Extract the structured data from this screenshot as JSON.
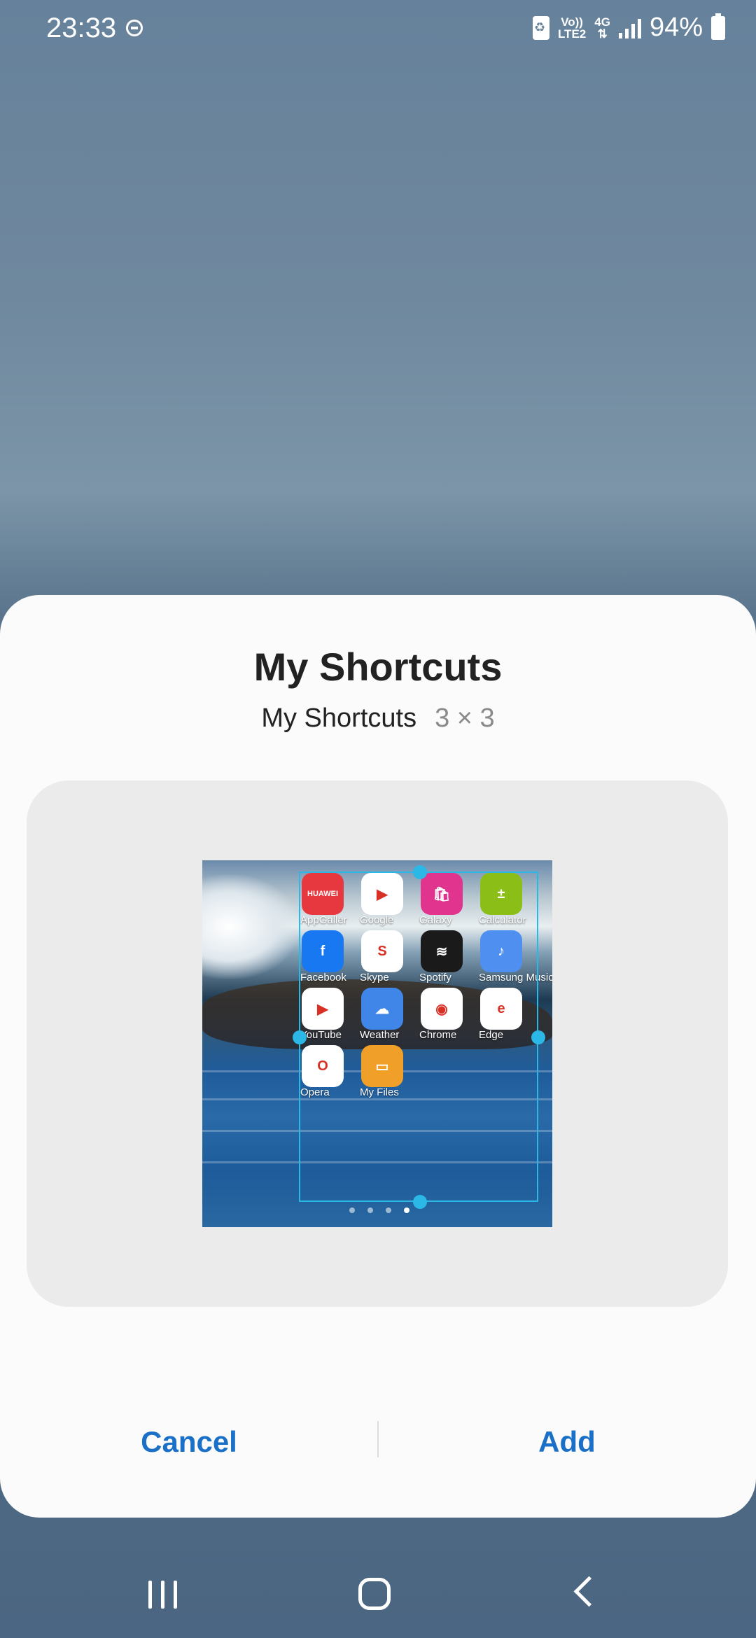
{
  "status_bar": {
    "time": "23:33",
    "network_line1": "Vo))",
    "network_line2": "LTE2",
    "network_type": "4G",
    "battery": "94%"
  },
  "sheet": {
    "title": "My Shortcuts",
    "subtitle": "My Shortcuts",
    "size": "3 × 3"
  },
  "preview": {
    "apps": [
      {
        "label": "AppGaller",
        "icon": "huawei-appgallery-icon",
        "color": "#e8383f",
        "glyph": "HUAWEI"
      },
      {
        "label": "Google",
        "icon": "google-play-icon",
        "color": "#ffffff",
        "glyph": "▶"
      },
      {
        "label": "Galaxy",
        "icon": "galaxy-store-icon",
        "color": "#e0348f",
        "glyph": "🛍"
      },
      {
        "label": "Calculator",
        "icon": "calculator-icon",
        "color": "#8bbf18",
        "glyph": "±"
      },
      {
        "label": "Facebook",
        "icon": "facebook-icon",
        "color": "#1778f2",
        "glyph": "f"
      },
      {
        "label": "Skype",
        "icon": "skype-icon",
        "color": "#ffffff",
        "glyph": "S"
      },
      {
        "label": "Spotify",
        "icon": "spotify-icon",
        "color": "#1a1a1a",
        "glyph": "≋"
      },
      {
        "label": "Samsung Music",
        "icon": "samsung-music-icon",
        "color": "#4f8ff0",
        "glyph": "♪"
      },
      {
        "label": "YouTube",
        "icon": "youtube-icon",
        "color": "#ffffff",
        "glyph": "▶"
      },
      {
        "label": "Weather",
        "icon": "weather-icon",
        "color": "#3f86e8",
        "glyph": "☁"
      },
      {
        "label": "Chrome",
        "icon": "chrome-icon",
        "color": "#ffffff",
        "glyph": "◉"
      },
      {
        "label": "Edge",
        "icon": "edge-icon",
        "color": "#ffffff",
        "glyph": "e"
      },
      {
        "label": "Opera",
        "icon": "opera-icon",
        "color": "#ffffff",
        "glyph": "O"
      },
      {
        "label": "My Files",
        "icon": "my-files-icon",
        "color": "#f0a028",
        "glyph": "▭"
      }
    ],
    "page_count": 4,
    "active_page": 4
  },
  "actions": {
    "cancel": "Cancel",
    "add": "Add"
  },
  "colors": {
    "accent": "#1a6fc6",
    "selection": "#2bb8e6"
  }
}
